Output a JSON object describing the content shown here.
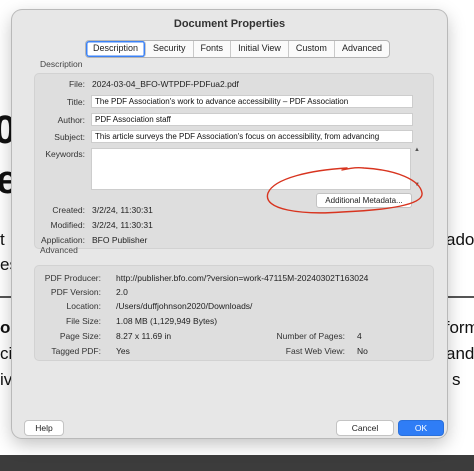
{
  "background": {
    "frag_zero": "0",
    "frag_e": "e",
    "frag_t": "t",
    "frag_es": "es",
    "frag_ado": "ado",
    "frag_or": "or",
    "frag_ci": "ci",
    "frag_iv": "iv",
    "frag_form": "tform",
    "frag_and": "and",
    "frag_s": "s"
  },
  "dialog": {
    "title": "Document Properties",
    "tabs": [
      "Description",
      "Security",
      "Fonts",
      "Initial View",
      "Custom",
      "Advanced"
    ],
    "active_tab": "Description",
    "description": {
      "heading": "Description",
      "file_label": "File:",
      "file_value": "2024-03-04_BFO-WTPDF-PDFua2.pdf",
      "title_label": "Title:",
      "title_value": "The PDF Association's work to advance accessibility – PDF Association",
      "author_label": "Author:",
      "author_value": "PDF Association staff",
      "subject_label": "Subject:",
      "subject_value": "This article surveys the PDF Association's focus on accessibility, from advancing",
      "keywords_label": "Keywords:",
      "keywords_value": "",
      "created_label": "Created:",
      "created_value": "3/2/24, 11:30:31",
      "modified_label": "Modified:",
      "modified_value": "3/2/24, 11:30:31",
      "application_label": "Application:",
      "application_value": "BFO Publisher",
      "metadata_button": "Additional Metadata..."
    },
    "advanced": {
      "heading": "Advanced",
      "producer_label": "PDF Producer:",
      "producer_value": "http://publisher.bfo.com/?version=work-47115M-20240302T163024",
      "version_label": "PDF Version:",
      "version_value": "2.0",
      "location_label": "Location:",
      "location_value": "/Users/duffjohnson2020/Downloads/",
      "filesize_label": "File Size:",
      "filesize_value": "1.08 MB (1,129,949 Bytes)",
      "pagesize_label": "Page Size:",
      "pagesize_value": "8.27 x 11.69 in",
      "pages_label": "Number of Pages:",
      "pages_value": "4",
      "tagged_label": "Tagged PDF:",
      "tagged_value": "Yes",
      "fastweb_label": "Fast Web View:",
      "fastweb_value": "No"
    },
    "buttons": {
      "help": "Help",
      "cancel": "Cancel",
      "ok": "OK"
    },
    "colors": {
      "annotation": "#d8341f",
      "ok_button": "#2f7df6",
      "focus": "#3b82f6"
    }
  }
}
